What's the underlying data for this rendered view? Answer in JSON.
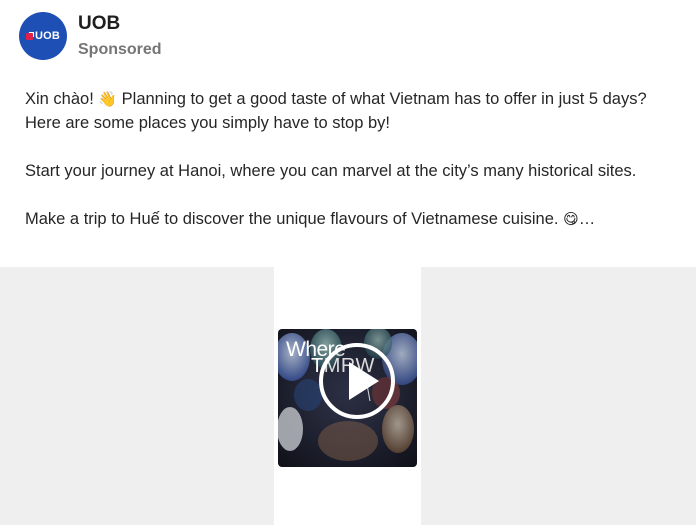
{
  "advertiser": {
    "name": "UOB",
    "logo_text": "UOB",
    "label": "Sponsored",
    "brand_color": "#1d4fb4",
    "mark_color": "#e0214b"
  },
  "post": {
    "paragraph1_a": "Xin chào! ",
    "paragraph1_emoji": "👋",
    "paragraph1_b": " Planning to get a good taste of what Vietnam has to offer in just 5 days? Here are some places you simply have to stop by!",
    "paragraph2": "Start your journey at Hanoi, where you can marvel at the city’s many historical sites.",
    "paragraph3_a": "Make a trip to Huế to discover the unique flavours of Vietnamese cuisine. ",
    "paragraph3_emoji": "😋",
    "ellipsis": "…"
  },
  "media": {
    "type": "video",
    "overlay_line1": "Where",
    "overlay_line2": "TMRW",
    "play_icon": "play-icon"
  }
}
